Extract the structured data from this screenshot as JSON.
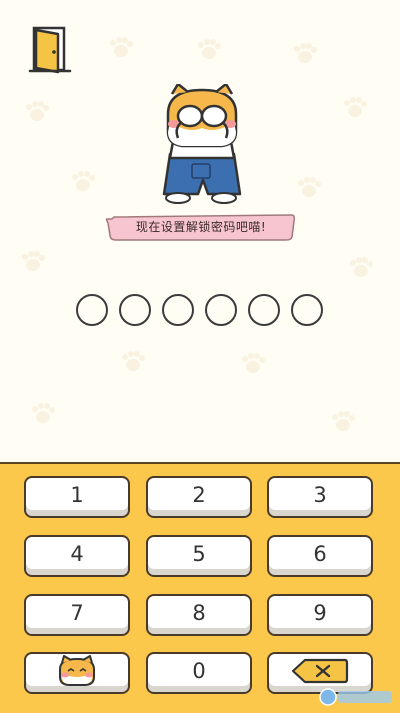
{
  "prompt": {
    "text": "现在设置解锁密码吧喵!"
  },
  "pin": {
    "length": 6,
    "filled": 0
  },
  "keypad": {
    "k1": "1",
    "k2": "2",
    "k3": "3",
    "k4": "4",
    "k5": "5",
    "k6": "6",
    "k7": "7",
    "k8": "8",
    "k9": "9",
    "k0": "0"
  },
  "icons": {
    "exit": "door-exit-icon",
    "cat_key": "cat-face-icon",
    "backspace": "backspace-icon"
  },
  "colors": {
    "keypad_bg": "#fbc84b",
    "page_bg": "#fffdf4",
    "bubble_pink": "#f7c5d0",
    "pants_blue": "#3b6fb0",
    "cat_orange": "#f6b84a"
  }
}
